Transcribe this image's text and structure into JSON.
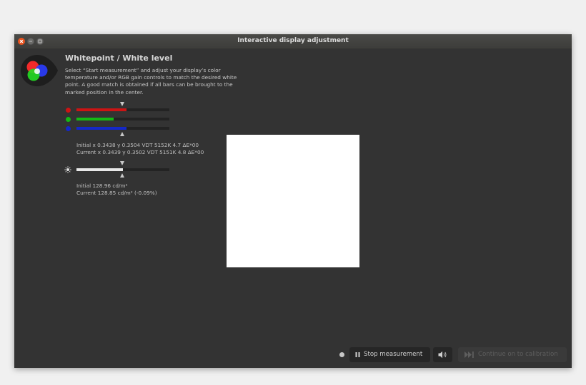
{
  "window": {
    "title": "Interactive display adjustment"
  },
  "titlebar_buttons": [
    "close",
    "minimize",
    "maximize"
  ],
  "heading": "Whitepoint / White level",
  "description": "Select “Start measurement” and adjust your display’s color temperature and/or RGB gain controls to match the desired white point. A good match is obtained if all bars can be brought to the marked position in the center.",
  "whitepoint": {
    "channels": [
      {
        "name": "red",
        "color": "#cc1414",
        "level": 0.54
      },
      {
        "name": "green",
        "color": "#14b814",
        "level": 0.4
      },
      {
        "name": "blue",
        "color": "#1428c8",
        "level": 0.54
      }
    ],
    "initial": "Initial x 0.3438 y 0.3504 VDT 5152K 4.7 ΔE*00",
    "current": "Current x 0.3439 y 0.3502 VDT 5151K 4.8 ΔE*00"
  },
  "luminance": {
    "color": "#e8e8e8",
    "level": 0.5,
    "initial": "Initial 128.96 cd/m²",
    "current": "Current 128.85 cd/m² (-0.09%)"
  },
  "icons": {
    "logo": "rgb-circles-icon",
    "brightness": "sun-icon",
    "stop": "pause-icon",
    "sound": "speaker-icon",
    "continue": "skip-forward-icon"
  },
  "buttons": {
    "stop": "Stop measurement",
    "continue": "Continue on to calibration"
  },
  "colors": {
    "accent_close": "#e95420",
    "window_bg": "#333333"
  }
}
